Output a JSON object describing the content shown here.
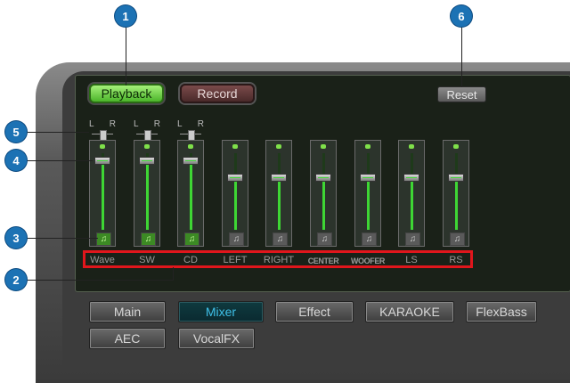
{
  "top_buttons": {
    "playback": "Playback",
    "record": "Record",
    "reset": "Reset"
  },
  "balance": {
    "left": "L",
    "right": "R"
  },
  "channels": [
    {
      "label": "Wave",
      "level": 0.92,
      "muted": false,
      "small": false,
      "lr": true
    },
    {
      "label": "SW",
      "level": 0.92,
      "muted": false,
      "small": false,
      "lr": true
    },
    {
      "label": "CD",
      "level": 0.92,
      "muted": false,
      "small": false,
      "lr": true
    },
    {
      "label": "LEFT",
      "level": 0.7,
      "muted": true,
      "small": false,
      "lr": false
    },
    {
      "label": "RIGHT",
      "level": 0.7,
      "muted": true,
      "small": false,
      "lr": false
    },
    {
      "label": "CENTER",
      "level": 0.7,
      "muted": true,
      "small": true,
      "lr": false
    },
    {
      "label": "WOOFER",
      "level": 0.7,
      "muted": true,
      "small": true,
      "lr": false
    },
    {
      "label": "LS",
      "level": 0.7,
      "muted": true,
      "small": false,
      "lr": false
    },
    {
      "label": "RS",
      "level": 0.7,
      "muted": true,
      "small": false,
      "lr": false
    }
  ],
  "tabs_row1": [
    "Main",
    "Mixer",
    "Effect",
    "KARAOKE",
    "FlexBass"
  ],
  "tabs_row2": [
    "AEC",
    "VocalFX"
  ],
  "active_tab": "Mixer",
  "callouts": [
    "1",
    "2",
    "3",
    "4",
    "5",
    "6"
  ],
  "colors": {
    "accent_green": "#3ed634",
    "callout_blue": "#1c72b4",
    "highlight_red": "#e0161c",
    "active_tab_text": "#3fc0e8"
  }
}
